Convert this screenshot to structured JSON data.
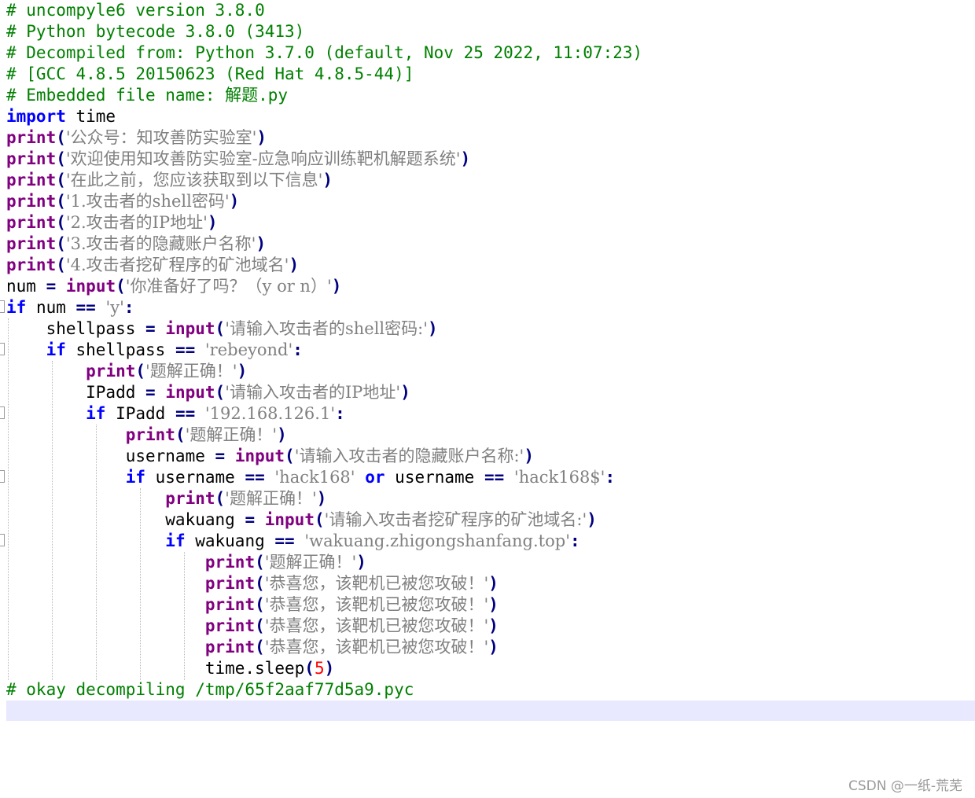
{
  "lines": [
    {
      "parts": [
        {
          "t": "# uncompyle6 version 3.8.0",
          "c": "cm"
        }
      ]
    },
    {
      "parts": [
        {
          "t": "# Python bytecode 3.8.0 (3413)",
          "c": "cm"
        }
      ]
    },
    {
      "parts": [
        {
          "t": "# Decompiled from: Python 3.7.0 (default, Nov 25 2022, 11:07:23)",
          "c": "cm"
        }
      ]
    },
    {
      "parts": [
        {
          "t": "# [GCC 4.8.5 20150623 (Red Hat 4.8.5-44)]",
          "c": "cm"
        }
      ]
    },
    {
      "parts": [
        {
          "t": "# Embedded file name: 解题.py",
          "c": "cm"
        }
      ]
    },
    {
      "parts": [
        {
          "t": "import",
          "c": "kw"
        },
        {
          "t": " time",
          "c": ""
        }
      ]
    },
    {
      "parts": [
        {
          "t": "print",
          "c": "fn"
        },
        {
          "t": "(",
          "c": "op"
        },
        {
          "t": "'公众号：知攻善防实验室'",
          "c": "st"
        },
        {
          "t": ")",
          "c": "op"
        }
      ]
    },
    {
      "parts": [
        {
          "t": "print",
          "c": "fn"
        },
        {
          "t": "(",
          "c": "op"
        },
        {
          "t": "'欢迎使用知攻善防实验室-应急响应训练靶机解题系统'",
          "c": "st"
        },
        {
          "t": ")",
          "c": "op"
        }
      ]
    },
    {
      "parts": [
        {
          "t": "print",
          "c": "fn"
        },
        {
          "t": "(",
          "c": "op"
        },
        {
          "t": "'在此之前，您应该获取到以下信息'",
          "c": "st"
        },
        {
          "t": ")",
          "c": "op"
        }
      ]
    },
    {
      "parts": [
        {
          "t": "print",
          "c": "fn"
        },
        {
          "t": "(",
          "c": "op"
        },
        {
          "t": "'1.攻击者的shell密码'",
          "c": "st"
        },
        {
          "t": ")",
          "c": "op"
        }
      ]
    },
    {
      "parts": [
        {
          "t": "print",
          "c": "fn"
        },
        {
          "t": "(",
          "c": "op"
        },
        {
          "t": "'2.攻击者的IP地址'",
          "c": "st"
        },
        {
          "t": ")",
          "c": "op"
        }
      ]
    },
    {
      "parts": [
        {
          "t": "print",
          "c": "fn"
        },
        {
          "t": "(",
          "c": "op"
        },
        {
          "t": "'3.攻击者的隐藏账户名称'",
          "c": "st"
        },
        {
          "t": ")",
          "c": "op"
        }
      ]
    },
    {
      "parts": [
        {
          "t": "print",
          "c": "fn"
        },
        {
          "t": "(",
          "c": "op"
        },
        {
          "t": "'4.攻击者挖矿程序的矿池域名'",
          "c": "st"
        },
        {
          "t": ")",
          "c": "op"
        }
      ]
    },
    {
      "parts": [
        {
          "t": "num ",
          "c": ""
        },
        {
          "t": "=",
          "c": "op"
        },
        {
          "t": " ",
          "c": ""
        },
        {
          "t": "input",
          "c": "fn"
        },
        {
          "t": "(",
          "c": "op"
        },
        {
          "t": "'你准备好了吗？（y or n）'",
          "c": "st"
        },
        {
          "t": ")",
          "c": "op"
        }
      ]
    },
    {
      "parts": [
        {
          "t": "if",
          "c": "kw"
        },
        {
          "t": " num ",
          "c": ""
        },
        {
          "t": "==",
          "c": "op"
        },
        {
          "t": " ",
          "c": ""
        },
        {
          "t": "'y'",
          "c": "st"
        },
        {
          "t": ":",
          "c": "op"
        }
      ]
    },
    {
      "parts": [
        {
          "t": "    shellpass ",
          "c": ""
        },
        {
          "t": "=",
          "c": "op"
        },
        {
          "t": " ",
          "c": ""
        },
        {
          "t": "input",
          "c": "fn"
        },
        {
          "t": "(",
          "c": "op"
        },
        {
          "t": "'请输入攻击者的shell密码:'",
          "c": "st"
        },
        {
          "t": ")",
          "c": "op"
        }
      ]
    },
    {
      "parts": [
        {
          "t": "    ",
          "c": ""
        },
        {
          "t": "if",
          "c": "kw"
        },
        {
          "t": " shellpass ",
          "c": ""
        },
        {
          "t": "==",
          "c": "op"
        },
        {
          "t": " ",
          "c": ""
        },
        {
          "t": "'rebeyond'",
          "c": "st"
        },
        {
          "t": ":",
          "c": "op"
        }
      ]
    },
    {
      "parts": [
        {
          "t": "        ",
          "c": ""
        },
        {
          "t": "print",
          "c": "fn"
        },
        {
          "t": "(",
          "c": "op"
        },
        {
          "t": "'题解正确！'",
          "c": "st"
        },
        {
          "t": ")",
          "c": "op"
        }
      ]
    },
    {
      "parts": [
        {
          "t": "        IPadd ",
          "c": ""
        },
        {
          "t": "=",
          "c": "op"
        },
        {
          "t": " ",
          "c": ""
        },
        {
          "t": "input",
          "c": "fn"
        },
        {
          "t": "(",
          "c": "op"
        },
        {
          "t": "'请输入攻击者的IP地址'",
          "c": "st"
        },
        {
          "t": ")",
          "c": "op"
        }
      ]
    },
    {
      "parts": [
        {
          "t": "        ",
          "c": ""
        },
        {
          "t": "if",
          "c": "kw"
        },
        {
          "t": " IPadd ",
          "c": ""
        },
        {
          "t": "==",
          "c": "op"
        },
        {
          "t": " ",
          "c": ""
        },
        {
          "t": "'192.168.126.1'",
          "c": "st"
        },
        {
          "t": ":",
          "c": "op"
        }
      ]
    },
    {
      "parts": [
        {
          "t": "            ",
          "c": ""
        },
        {
          "t": "print",
          "c": "fn"
        },
        {
          "t": "(",
          "c": "op"
        },
        {
          "t": "'题解正确！'",
          "c": "st"
        },
        {
          "t": ")",
          "c": "op"
        }
      ]
    },
    {
      "parts": [
        {
          "t": "            username ",
          "c": ""
        },
        {
          "t": "=",
          "c": "op"
        },
        {
          "t": " ",
          "c": ""
        },
        {
          "t": "input",
          "c": "fn"
        },
        {
          "t": "(",
          "c": "op"
        },
        {
          "t": "'请输入攻击者的隐藏账户名称:'",
          "c": "st"
        },
        {
          "t": ")",
          "c": "op"
        }
      ]
    },
    {
      "parts": [
        {
          "t": "            ",
          "c": ""
        },
        {
          "t": "if",
          "c": "kw"
        },
        {
          "t": " username ",
          "c": ""
        },
        {
          "t": "==",
          "c": "op"
        },
        {
          "t": " ",
          "c": ""
        },
        {
          "t": "'hack168'",
          "c": "st"
        },
        {
          "t": " ",
          "c": ""
        },
        {
          "t": "or",
          "c": "kw"
        },
        {
          "t": " username ",
          "c": ""
        },
        {
          "t": "==",
          "c": "op"
        },
        {
          "t": " ",
          "c": ""
        },
        {
          "t": "'hack168$'",
          "c": "st"
        },
        {
          "t": ":",
          "c": "op"
        }
      ]
    },
    {
      "parts": [
        {
          "t": "                ",
          "c": ""
        },
        {
          "t": "print",
          "c": "fn"
        },
        {
          "t": "(",
          "c": "op"
        },
        {
          "t": "'题解正确！'",
          "c": "st"
        },
        {
          "t": ")",
          "c": "op"
        }
      ]
    },
    {
      "parts": [
        {
          "t": "                wakuang ",
          "c": ""
        },
        {
          "t": "=",
          "c": "op"
        },
        {
          "t": " ",
          "c": ""
        },
        {
          "t": "input",
          "c": "fn"
        },
        {
          "t": "(",
          "c": "op"
        },
        {
          "t": "'请输入攻击者挖矿程序的矿池域名:'",
          "c": "st"
        },
        {
          "t": ")",
          "c": "op"
        }
      ]
    },
    {
      "parts": [
        {
          "t": "                ",
          "c": ""
        },
        {
          "t": "if",
          "c": "kw"
        },
        {
          "t": " wakuang ",
          "c": ""
        },
        {
          "t": "==",
          "c": "op"
        },
        {
          "t": " ",
          "c": ""
        },
        {
          "t": "'wakuang.zhigongshanfang.top'",
          "c": "st"
        },
        {
          "t": ":",
          "c": "op"
        }
      ]
    },
    {
      "parts": [
        {
          "t": "                    ",
          "c": ""
        },
        {
          "t": "print",
          "c": "fn"
        },
        {
          "t": "(",
          "c": "op"
        },
        {
          "t": "'题解正确！'",
          "c": "st"
        },
        {
          "t": ")",
          "c": "op"
        }
      ]
    },
    {
      "parts": [
        {
          "t": "                    ",
          "c": ""
        },
        {
          "t": "print",
          "c": "fn"
        },
        {
          "t": "(",
          "c": "op"
        },
        {
          "t": "'恭喜您，该靶机已被您攻破！'",
          "c": "st"
        },
        {
          "t": ")",
          "c": "op"
        }
      ]
    },
    {
      "parts": [
        {
          "t": "                    ",
          "c": ""
        },
        {
          "t": "print",
          "c": "fn"
        },
        {
          "t": "(",
          "c": "op"
        },
        {
          "t": "'恭喜您，该靶机已被您攻破！'",
          "c": "st"
        },
        {
          "t": ")",
          "c": "op"
        }
      ]
    },
    {
      "parts": [
        {
          "t": "                    ",
          "c": ""
        },
        {
          "t": "print",
          "c": "fn"
        },
        {
          "t": "(",
          "c": "op"
        },
        {
          "t": "'恭喜您，该靶机已被您攻破！'",
          "c": "st"
        },
        {
          "t": ")",
          "c": "op"
        }
      ]
    },
    {
      "parts": [
        {
          "t": "                    ",
          "c": ""
        },
        {
          "t": "print",
          "c": "fn"
        },
        {
          "t": "(",
          "c": "op"
        },
        {
          "t": "'恭喜您，该靶机已被您攻破！'",
          "c": "st"
        },
        {
          "t": ")",
          "c": "op"
        }
      ]
    },
    {
      "parts": [
        {
          "t": "                    time.sleep",
          "c": ""
        },
        {
          "t": "(",
          "c": "op"
        },
        {
          "t": "5",
          "c": "nm"
        },
        {
          "t": ")",
          "c": "op"
        }
      ]
    },
    {
      "parts": [
        {
          "t": "# okay decompiling /tmp/65f2aaf77d5a9.pyc",
          "c": "cm"
        }
      ]
    }
  ],
  "watermark": "CSDN @一纸-荒芜",
  "colors": {
    "comment": "#008000",
    "keyword": "#0000ff",
    "builtin": "#800080",
    "string": "#808080",
    "operator": "#000080",
    "number": "#ff0000",
    "caret_line": "#e8e8ff"
  }
}
